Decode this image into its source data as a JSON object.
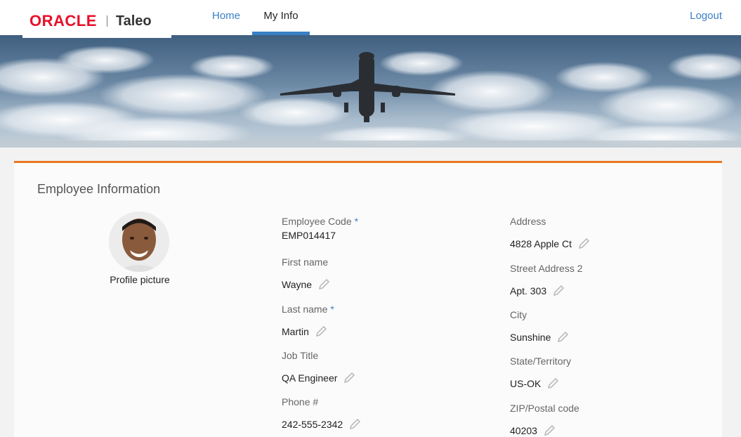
{
  "header": {
    "logo_oracle": "ORACLE",
    "logo_taleo": "Taleo",
    "nav": {
      "home": "Home",
      "my_info": "My Info",
      "logout": "Logout"
    }
  },
  "section": {
    "title": "Employee Information"
  },
  "profile": {
    "label": "Profile picture"
  },
  "fields": {
    "employee_code": {
      "label": "Employee Code",
      "required": "*",
      "value": "EMP014417"
    },
    "first_name": {
      "label": "First name",
      "value": "Wayne"
    },
    "last_name": {
      "label": "Last name",
      "required": "*",
      "value": "Martin"
    },
    "job_title": {
      "label": "Job Title",
      "value": "QA Engineer"
    },
    "phone": {
      "label": "Phone #",
      "value": "242-555-2342"
    },
    "address": {
      "label": "Address",
      "value": "4828 Apple Ct"
    },
    "street2": {
      "label": "Street Address 2",
      "value": "Apt. 303"
    },
    "city": {
      "label": "City",
      "value": "Sunshine"
    },
    "state": {
      "label": "State/Territory",
      "value": "US-OK"
    },
    "zip": {
      "label": "ZIP/Postal code",
      "value": "40203"
    }
  },
  "colors": {
    "accent": "#3a7fc6",
    "orange": "#e87722",
    "oracle_red": "#e8102a"
  }
}
